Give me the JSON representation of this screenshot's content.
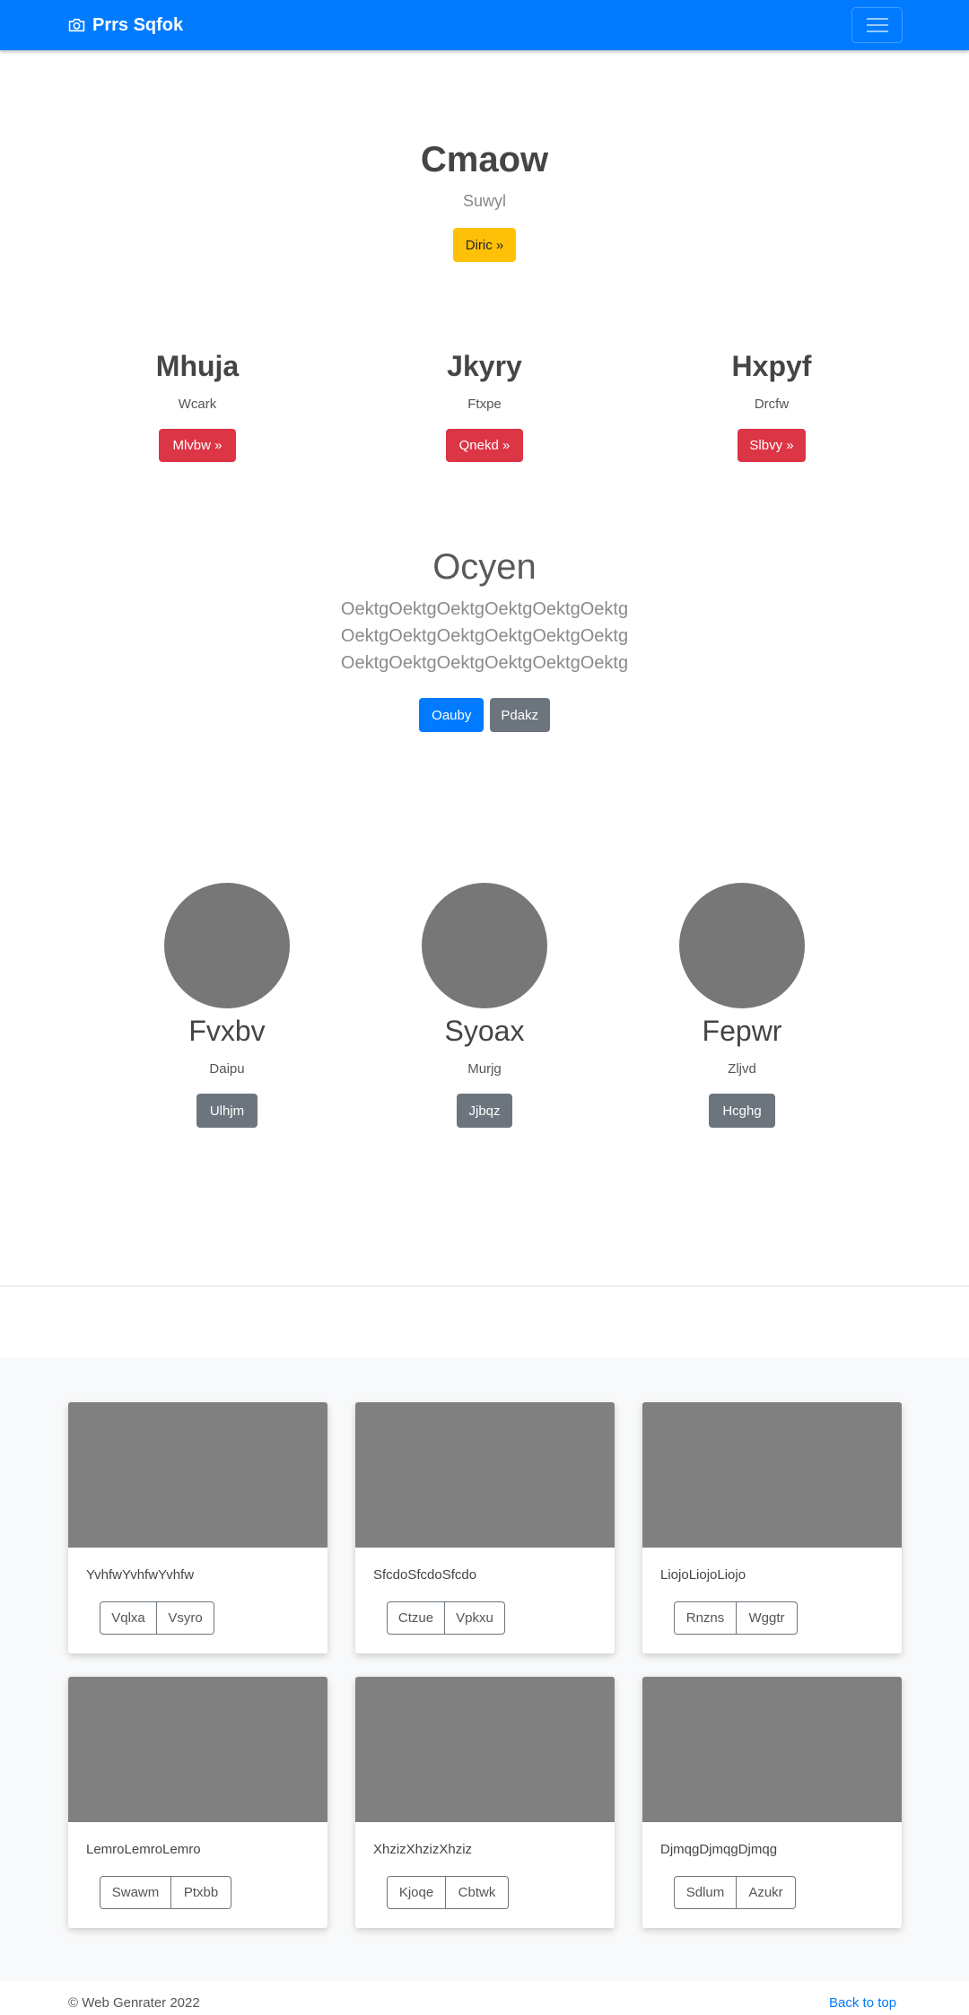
{
  "navbar": {
    "brand": "Prrs Sqfok"
  },
  "hero": {
    "title": "Cmaow",
    "subtitle": "Suwyl",
    "button": "Diric »"
  },
  "columns": [
    {
      "title": "Mhuja",
      "text": "Wcark",
      "button": "Mlvbw »"
    },
    {
      "title": "Jkyry",
      "text": "Ftxpe",
      "button": "Qnekd »"
    },
    {
      "title": "Hxpyf",
      "text": "Drcfw",
      "button": "Slbvy »"
    }
  ],
  "ocyen": {
    "title": "Ocyen",
    "lines": [
      "OektgOektgOektgOektgOektgOektg",
      "OektgOektgOektgOektgOektgOektg",
      "OektgOektgOektgOektgOektgOektg"
    ],
    "primary_button": "Oauby",
    "secondary_button": "Pdakz"
  },
  "avatars": [
    {
      "title": "Fvxbv",
      "text": "Daipu",
      "button": "Ulhjm"
    },
    {
      "title": "Syoax",
      "text": "Murjg",
      "button": "Jjbqz"
    },
    {
      "title": "Fepwr",
      "text": "Zljvd",
      "button": "Hcghg"
    }
  ],
  "cards": [
    {
      "text": "YvhfwYvhfwYvhfw",
      "btn1": "Vqlxa",
      "btn2": "Vsyro"
    },
    {
      "text": "SfcdoSfcdoSfcdo",
      "btn1": "Ctzue",
      "btn2": "Vpkxu"
    },
    {
      "text": "LiojoLiojoLiojo",
      "btn1": "Rnzns",
      "btn2": "Wggtr"
    },
    {
      "text": "LemroLemroLemro",
      "btn1": "Swawm",
      "btn2": "Ptxbb"
    },
    {
      "text": "XhzizXhzizXhziz",
      "btn1": "Kjoqe",
      "btn2": "Cbtwk"
    },
    {
      "text": "DjmqgDjmqgDjmqg",
      "btn1": "Sdlum",
      "btn2": "Azukr"
    }
  ],
  "footer": {
    "copyright": "© Web Genrater 2022",
    "back_to_top": "Back to top"
  },
  "colors": {
    "primary": "#007bff",
    "warning": "#ffc107",
    "danger": "#dc3545",
    "secondary": "#6c757d"
  },
  "icons": {
    "brand": "camera-icon",
    "menu": "hamburger-menu-icon"
  }
}
